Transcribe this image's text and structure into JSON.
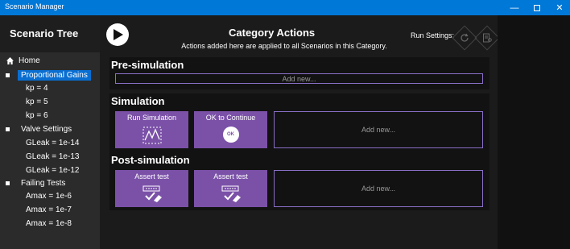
{
  "window": {
    "title": "Scenario Manager",
    "minimize": "—",
    "close": "✕"
  },
  "sidebar": {
    "title": "Scenario Tree",
    "home": "Home",
    "groups": [
      {
        "label": "Proportional Gains",
        "selected": true,
        "children": [
          "kp = 4",
          "kp = 5",
          "kp = 6"
        ]
      },
      {
        "label": "Valve Settings",
        "selected": false,
        "children": [
          "GLeak = 1e-14",
          "GLeak = 1e-13",
          "GLeak = 1e-12"
        ]
      },
      {
        "label": "Failing Tests",
        "selected": false,
        "children": [
          "Amax = 1e-6",
          "Amax = 1e-7",
          "Amax = 1e-8"
        ]
      }
    ]
  },
  "main": {
    "title": "Category Actions",
    "subtitle": "Actions added here are applied to all Scenarios in this Category.",
    "run_settings_label": "Run Settings:",
    "icons": {
      "play": "play-icon",
      "reset": "reset-icon",
      "config": "settings-icon"
    }
  },
  "sections": {
    "pre": {
      "title": "Pre-simulation",
      "add_new": "Add new..."
    },
    "sim": {
      "title": "Simulation",
      "actions": [
        {
          "label": "Run Simulation",
          "icon": "chart-icon"
        },
        {
          "label": "OK to Continue",
          "icon": "ok-icon",
          "icon_text": "OK"
        }
      ],
      "add_new": "Add new..."
    },
    "post": {
      "title": "Post-simulation",
      "actions": [
        {
          "label": "Assert test",
          "icon": "assert-icon"
        },
        {
          "label": "Assert test",
          "icon": "assert-icon"
        }
      ],
      "add_new": "Add new..."
    }
  },
  "colors": {
    "accent": "#0078d7",
    "card": "#7b51a8",
    "border": "#8a6fc7",
    "selected": "#0a6ed1"
  }
}
